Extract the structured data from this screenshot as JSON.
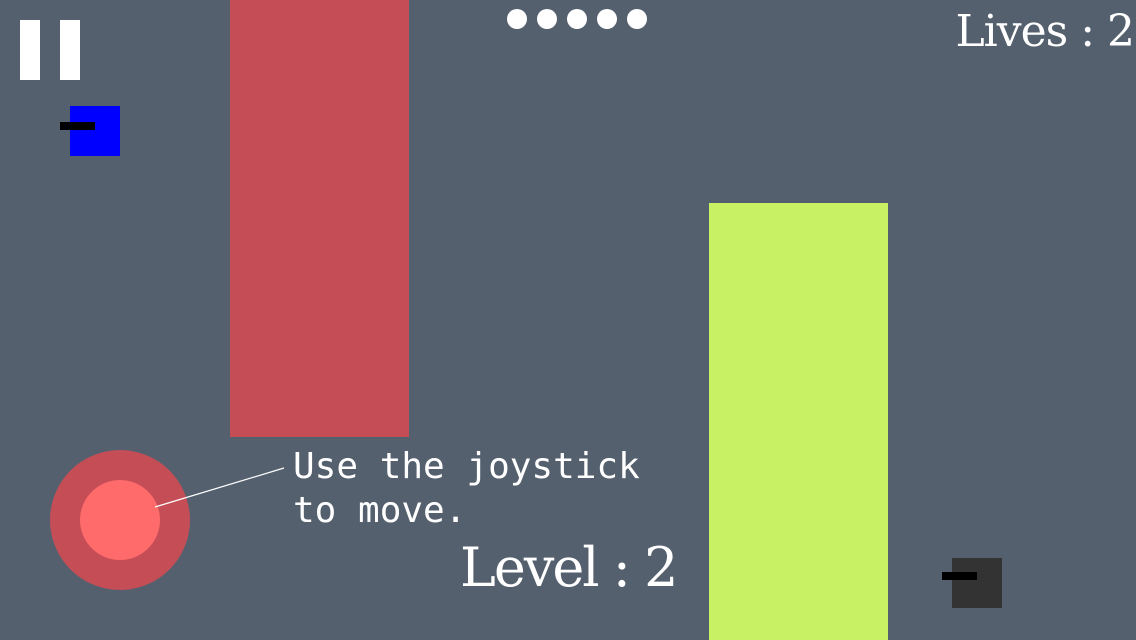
{
  "hud": {
    "lives_text": "Lives : 2",
    "level_text": "Level : 2",
    "progress_dots": 5
  },
  "tutorial": {
    "hint_text": "Use the joystick\nto move."
  },
  "colors": {
    "background": "#55606e",
    "player": "#0000ff",
    "enemy": "#333333",
    "wall_red": "#c44d56",
    "wall_green": "#c8f264",
    "joystick_base": "#c44d56",
    "joystick_knob": "#ff6b6b"
  },
  "icons": {
    "pause": "pause-icon"
  }
}
